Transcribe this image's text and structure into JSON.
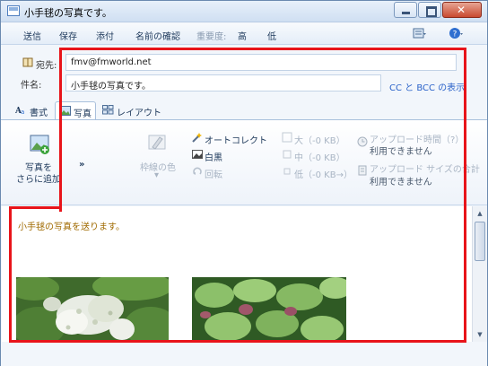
{
  "window": {
    "title": "小手毬の写真です。"
  },
  "toolbar": {
    "send": "送信",
    "save": "保存",
    "attach": "添付",
    "check_names": "名前の確認",
    "importance_label": "重要度:",
    "high": "高",
    "low": "低"
  },
  "header": {
    "to_label": "宛先:",
    "to_value": "fmv@fmworld.net",
    "subject_label": "件名:",
    "subject_value": "小手毬の写真です。",
    "show_cc_bcc": "CC と BCC の表示"
  },
  "tabs": [
    {
      "label": "書式",
      "icon": "format-icon"
    },
    {
      "label": "写真",
      "icon": "photo-icon",
      "active": true
    },
    {
      "label": "レイアウト",
      "icon": "layout-icon"
    }
  ],
  "ribbon": {
    "add_photos_line1": "写真を",
    "add_photos_line2": "さらに追加",
    "more": "»",
    "border_color": "枠線の色",
    "autocorrect": "オートコレクト",
    "black_white": "白黒",
    "rotate": "回転",
    "size_large": "大（-0 KB）",
    "size_medium": "中（-0 KB）",
    "size_small": "低（-0 KB→）",
    "upload_time": "アップロード時間（?）",
    "upload_time_status": "利用できません",
    "upload_size": "アップロード サイズの合計",
    "upload_size_status": "利用できません"
  },
  "body": {
    "text": "小手毬の写真を送ります。"
  },
  "colors": {
    "highlight": "#e8141a",
    "accent": "#1e395b",
    "link": "#2a62c9"
  }
}
